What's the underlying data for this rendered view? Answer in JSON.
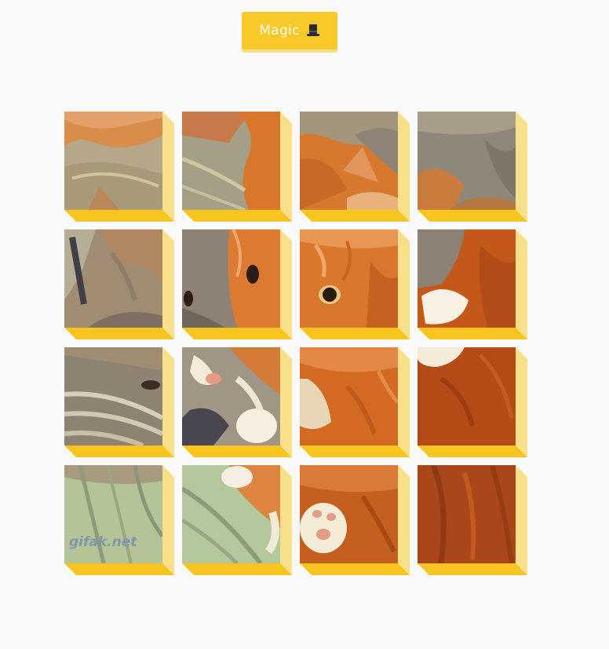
{
  "toolbar": {
    "magic_label": "Magic",
    "magic_icon": "top-hat-icon"
  },
  "puzzle": {
    "rows": 4,
    "cols": 4,
    "watermark": "gifak.net",
    "colors": {
      "tile_bottom": "#f8c520",
      "tile_side": "#f8e08a",
      "button": "#f9c929",
      "background": "#fafafa"
    }
  }
}
